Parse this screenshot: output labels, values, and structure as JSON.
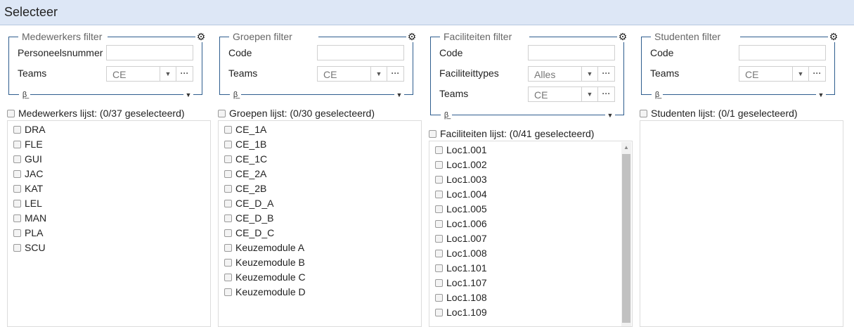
{
  "window": {
    "title": "Selecteer"
  },
  "columns": [
    {
      "filter": {
        "legend": "Medewerkers filter",
        "fields": [
          {
            "type": "text",
            "label": "Personeelsnummer",
            "value": ""
          },
          {
            "type": "select",
            "label": "Teams",
            "value": "CE"
          }
        ]
      },
      "list": {
        "header": "Medewerkers lijst: (0/37 geselecteerd)",
        "items": [
          "DRA",
          "FLE",
          "GUI",
          "JAC",
          "KAT",
          "LEL",
          "MAN",
          "PLA",
          "SCU"
        ]
      }
    },
    {
      "filter": {
        "legend": "Groepen filter",
        "fields": [
          {
            "type": "text",
            "label": "Code",
            "value": ""
          },
          {
            "type": "select",
            "label": "Teams",
            "value": "CE"
          }
        ]
      },
      "list": {
        "header": "Groepen lijst: (0/30 geselecteerd)",
        "items": [
          "CE_1A",
          "CE_1B",
          "CE_1C",
          "CE_2A",
          "CE_2B",
          "CE_D_A",
          "CE_D_B",
          "CE_D_C",
          "Keuzemodule A",
          "Keuzemodule B",
          "Keuzemodule C",
          "Keuzemodule D"
        ]
      }
    },
    {
      "filter": {
        "legend": "Faciliteiten filter",
        "fields": [
          {
            "type": "text",
            "label": "Code",
            "value": ""
          },
          {
            "type": "select",
            "label": "Faciliteittypes",
            "value": "Alles"
          },
          {
            "type": "select",
            "label": "Teams",
            "value": "CE"
          }
        ]
      },
      "list": {
        "header": "Faciliteiten lijst: (0/41 geselecteerd)",
        "items": [
          "Loc1.001",
          "Loc1.002",
          "Loc1.003",
          "Loc1.004",
          "Loc1.005",
          "Loc1.006",
          "Loc1.007",
          "Loc1.008",
          "Loc1.101",
          "Loc1.107",
          "Loc1.108",
          "Loc1.109"
        ]
      }
    },
    {
      "filter": {
        "legend": "Studenten filter",
        "fields": [
          {
            "type": "text",
            "label": "Code",
            "value": ""
          },
          {
            "type": "select",
            "label": "Teams",
            "value": "CE"
          }
        ]
      },
      "list": {
        "header": "Studenten lijst: (0/1 geselecteerd)",
        "items": []
      }
    }
  ],
  "icons": {
    "settings": "gear-icon",
    "clear_filter": "filter-clear-icon",
    "collapse": "caret-down-icon",
    "dropdown": "caret-down-icon",
    "more": "ellipsis-icon"
  }
}
